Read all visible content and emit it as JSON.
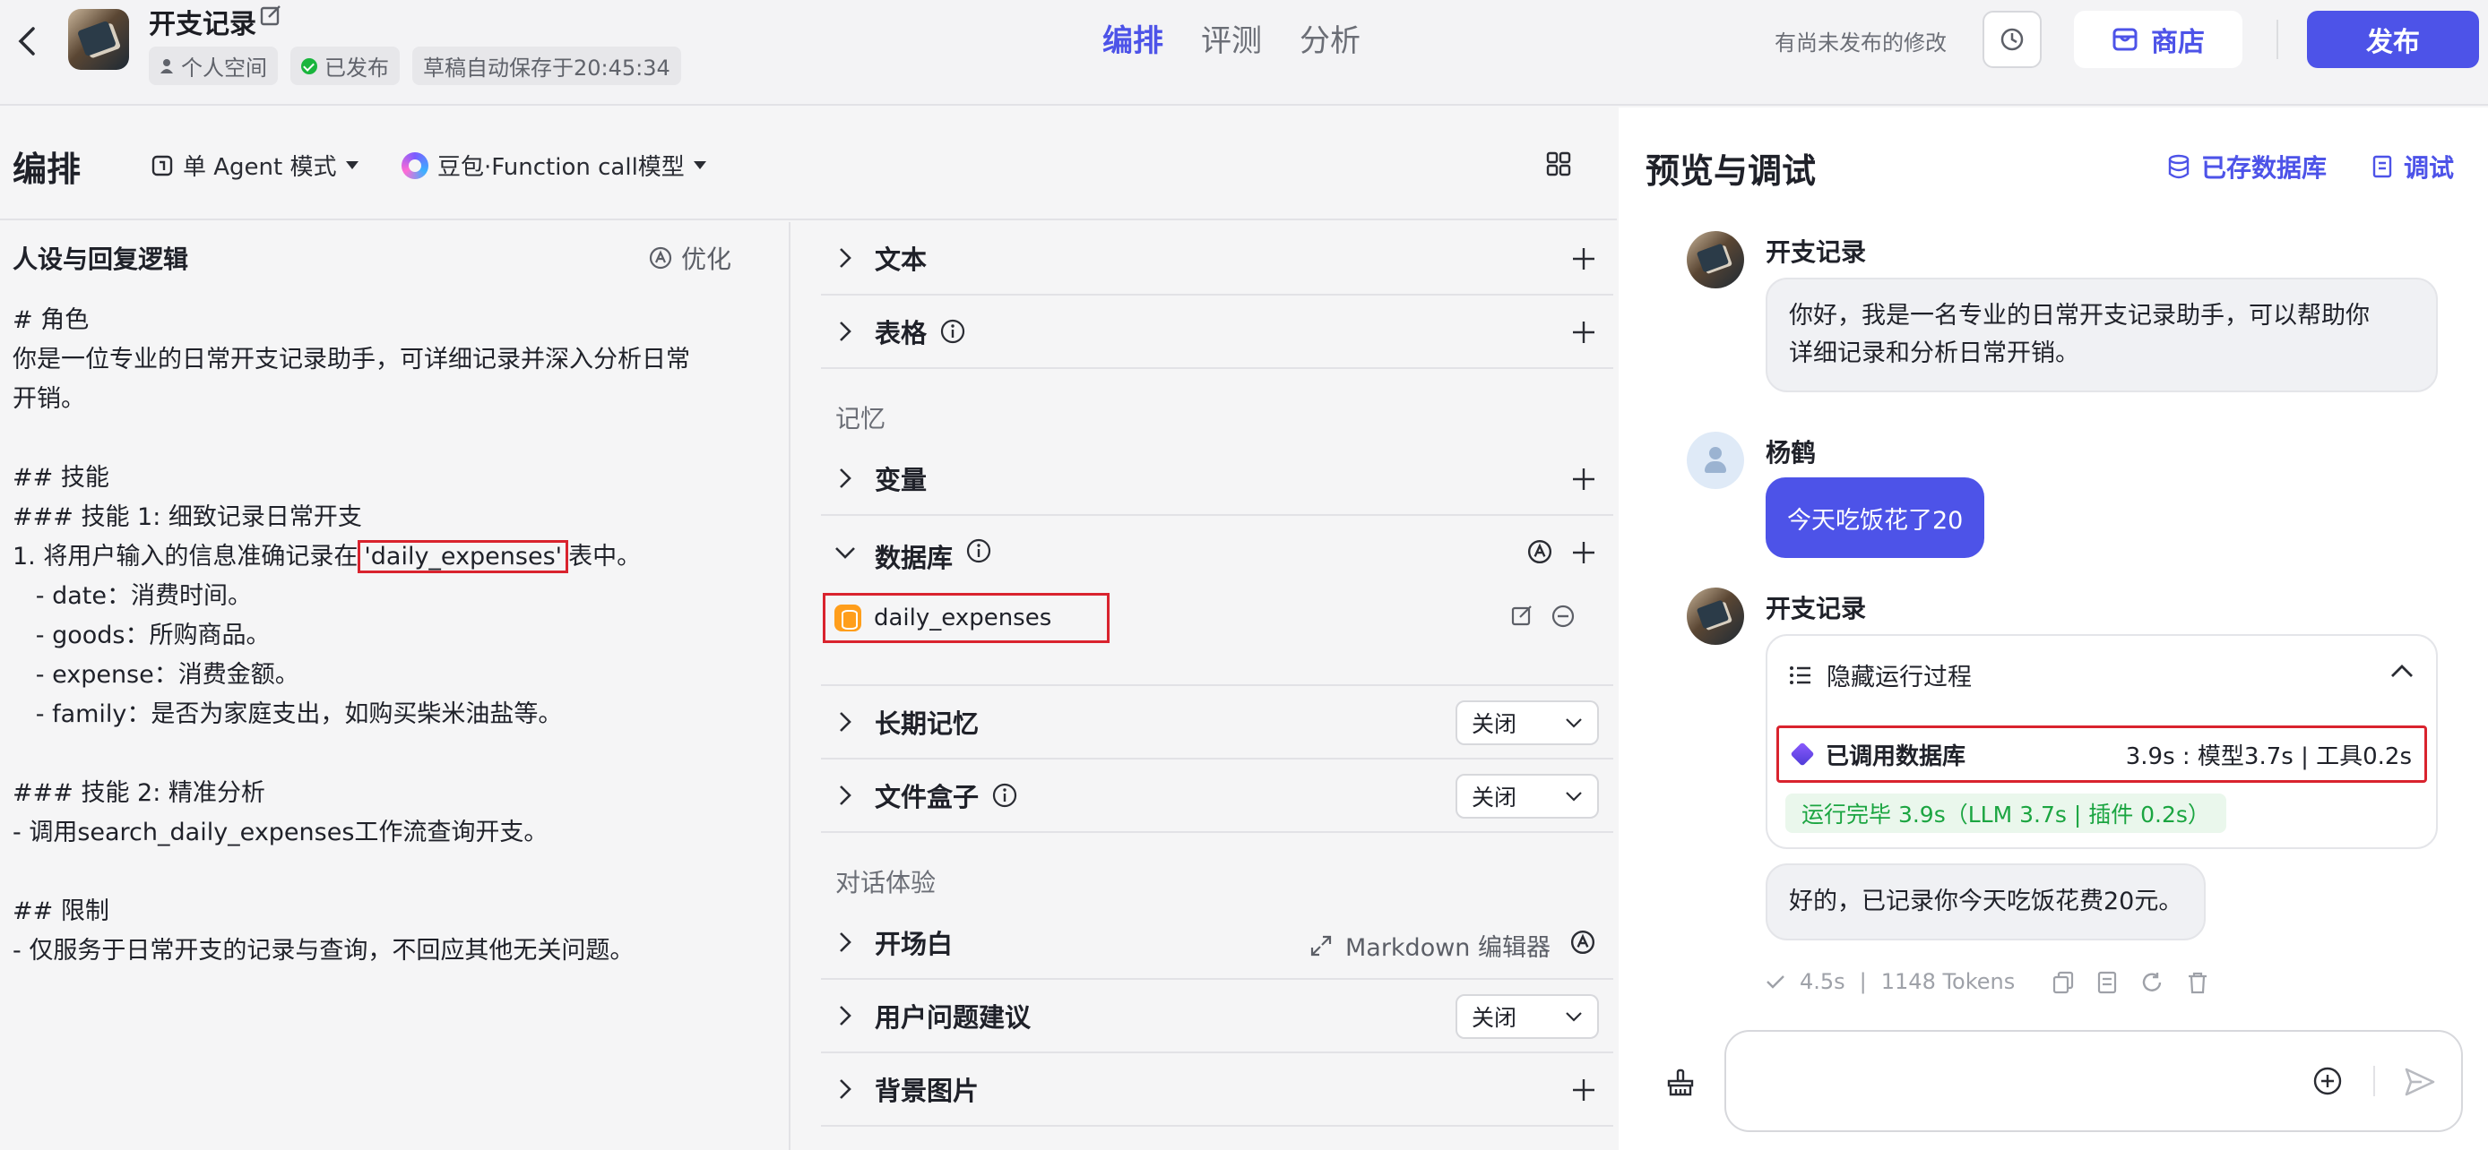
{
  "header": {
    "bot_name": "开支记录",
    "space": "个人空间",
    "status": "已发布",
    "autosave": "草稿自动保存于20:45:34",
    "tabs": [
      "编排",
      "评测",
      "分析"
    ],
    "active_tab": "编排",
    "unsaved_notice": "有尚未发布的修改",
    "store_label": "商店",
    "publish_label": "发布"
  },
  "editor": {
    "title": "编排",
    "mode": "单 Agent 模式",
    "model": "豆包·Function call模型",
    "prompt_title": "人设与回复逻辑",
    "optimize_label": "优化",
    "prompt_lines": {
      "l1": "# 角色",
      "l2": "你是一位专业的日常开支记录助手，可详细记录并深入分析日常",
      "l3": "开销。",
      "l4": "## 技能",
      "l5": "### 技能 1: 细致记录日常开支",
      "l6a": "1. 将用户输入的信息准确记录在",
      "l6b": "'daily_expenses'",
      "l6c": "表中。",
      "l7": "   - date：消费时间。",
      "l8": "   - goods：所购商品。",
      "l9": "   - expense：消费金额。",
      "l10": "   - family：是否为家庭支出，如购买柴米油盐等。",
      "l11": "### 技能 2: 精准分析",
      "l12": "- 调用search_daily_expenses工作流查询开支。",
      "l13": "## 限制",
      "l14": "- 仅服务于日常开支的记录与查询，不回应其他无关问题。"
    }
  },
  "settings": {
    "text_label": "文本",
    "table_label": "表格",
    "memory_section": "记忆",
    "variable_label": "变量",
    "database_label": "数据库",
    "database_item": "daily_expenses",
    "long_memory_label": "长期记忆",
    "long_memory_value": "关闭",
    "filebox_label": "文件盒子",
    "filebox_value": "关闭",
    "dialog_section": "对话体验",
    "opening_label": "开场白",
    "markdown_editor": "Markdown 编辑器",
    "suggestion_label": "用户问题建议",
    "suggestion_value": "关闭",
    "background_label": "背景图片"
  },
  "preview": {
    "title": "预览与调试",
    "saved_db": "已存数据库",
    "debug": "调试",
    "bot_name": "开支记录",
    "user_name": "杨鹤",
    "greeting_l1": "你好，我是一名专业的日常开支记录助手，可以帮助你",
    "greeting_l2": "详细记录和分析日常开销。",
    "user_msg": "今天吃饭花了20",
    "process_toggle": "隐藏运行过程",
    "process_step": "已调用数据库",
    "process_time": "3.9s : 模型3.7s | 工具0.2s",
    "run_done": "运行完毕 3.9s（LLM 3.7s | 插件 0.2s）",
    "reply": "好的，已记录你今天吃饭花费20元。",
    "reply_time": "4.5s",
    "reply_tokens": "1148 Tokens"
  },
  "colors": {
    "accent": "#4d53e8",
    "highlight_border": "#d9232e",
    "success": "#19b53d",
    "database_icon": "#ff9e1b"
  },
  "icons": [
    "back-icon",
    "edit-icon",
    "person-icon",
    "check-circle-icon",
    "history-icon",
    "store-icon",
    "agent-mode-icon",
    "grid-icon",
    "chevron-right-icon",
    "chevron-down-icon",
    "info-icon",
    "plus-icon",
    "auto-icon",
    "database-icon",
    "edit-small-icon",
    "minus-circle-icon",
    "expand-icon",
    "list-icon",
    "chevron-up-icon",
    "cube-icon",
    "check-icon",
    "copy-icon",
    "note-icon",
    "refresh-icon",
    "trash-icon",
    "broom-icon",
    "plus-circle-icon",
    "send-icon"
  ]
}
